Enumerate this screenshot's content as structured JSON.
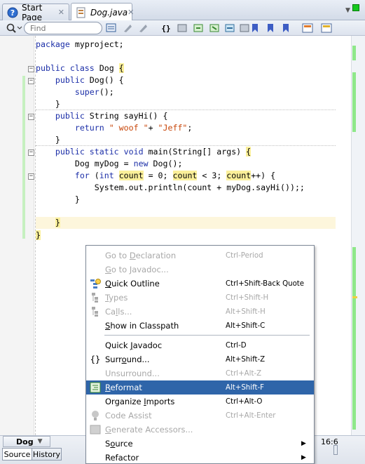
{
  "tabs": [
    {
      "label": "Start Page",
      "icon": "help-circle-icon"
    },
    {
      "label": "Dog.java",
      "icon": "java-file-icon"
    }
  ],
  "toolbar": {
    "find_placeholder": "Find"
  },
  "code": {
    "line1": {
      "kw": "package",
      "rest": " myproject;"
    },
    "line2": {
      "kw": "public class",
      "name": " Dog ",
      "brace": "{"
    },
    "line3": {
      "indent": "    ",
      "kw": "public",
      "rest": " Dog() {"
    },
    "line4": {
      "indent": "        ",
      "kw": "super",
      "rest": "();"
    },
    "line5": {
      "text": "    }"
    },
    "line6": {
      "indent": "    ",
      "kw": "public",
      "rest": " String sayHi() {"
    },
    "line7": {
      "indent": "        ",
      "kw": "return",
      "str1": " \" woof \"",
      "mid": "+ ",
      "str2": "\"Jeff\"",
      "end": ";"
    },
    "line8": {
      "text": "    }"
    },
    "line9": {
      "indent": "    ",
      "kw": "public static void",
      "rest": " main(String[] args) ",
      "brace": "{"
    },
    "line10": {
      "indent": "        ",
      "pre": "Dog myDog = ",
      "kw": "new",
      "rest": " Dog();"
    },
    "line11": {
      "indent": "        ",
      "kw": "for",
      "p1": " (",
      "kw2": "int",
      "sp": " ",
      "c1": "count",
      "p2": " = 0; ",
      "c2": "count",
      "p3": " < 3; ",
      "c3": "count",
      "p4": "++) {"
    },
    "line12": {
      "text": "            System.out.println(count + myDog.sayHi());;"
    },
    "line13": {
      "text": "        }"
    },
    "line14": {
      "indent": "    ",
      "brace": "}"
    },
    "line15": {
      "brace": "}"
    }
  },
  "status": {
    "nav": "Dog",
    "source_label": "Source",
    "history_label": "History",
    "position": "16:6"
  },
  "menu": {
    "items": [
      {
        "pre": "Go to ",
        "u": "D",
        "post": "eclaration",
        "key": "Ctrl-Period",
        "disabled": true
      },
      {
        "pre": "",
        "u": "G",
        "post": "o to Javadoc...",
        "key": "",
        "disabled": true
      },
      {
        "pre": "",
        "u": "Q",
        "post": "uick Outline",
        "key": "Ctrl+Shift-Back Quote",
        "icon": "quick-outline-icon"
      },
      {
        "pre": "",
        "u": "T",
        "post": "ypes",
        "key": "Ctrl+Shift-H",
        "disabled": true,
        "icon": "hierarchy-icon"
      },
      {
        "pre": "Ca",
        "u": "l",
        "post": "ls...",
        "key": "Alt+Shift-H",
        "disabled": true,
        "icon": "call-hierarchy-icon"
      },
      {
        "pre": "",
        "u": "S",
        "post": "how in Classpath",
        "key": "Alt+Shift-C"
      },
      {
        "pre": "Quick ",
        "u": "J",
        "post": "avadoc",
        "key": "Ctrl-D"
      },
      {
        "pre": "Surr",
        "u": "o",
        "post": "und...",
        "key": "Alt+Shift-Z",
        "icon": "braces-icon"
      },
      {
        "pre": "Unsurround...",
        "u": "",
        "post": "",
        "key": "Ctrl+Alt-Z",
        "disabled": true
      },
      {
        "pre": "",
        "u": "R",
        "post": "eformat",
        "key": "Alt+Shift-F",
        "selected": true,
        "icon": "reformat-icon"
      },
      {
        "pre": "Organize ",
        "u": "I",
        "post": "mports",
        "key": "Ctrl+Alt-O"
      },
      {
        "pre": "Code Assist",
        "u": "",
        "post": "",
        "key": "Ctrl+Alt-Enter",
        "disabled": true,
        "icon": "lightbulb-icon"
      },
      {
        "pre": "",
        "u": "G",
        "post": "enerate Accessors...",
        "key": "",
        "disabled": true,
        "icon": "generate-icon"
      },
      {
        "pre": "S",
        "u": "o",
        "post": "urce",
        "key": "",
        "submenu": true
      },
      {
        "pre": "Refactor",
        "u": "",
        "post": "",
        "key": "",
        "submenu": true
      }
    ]
  }
}
